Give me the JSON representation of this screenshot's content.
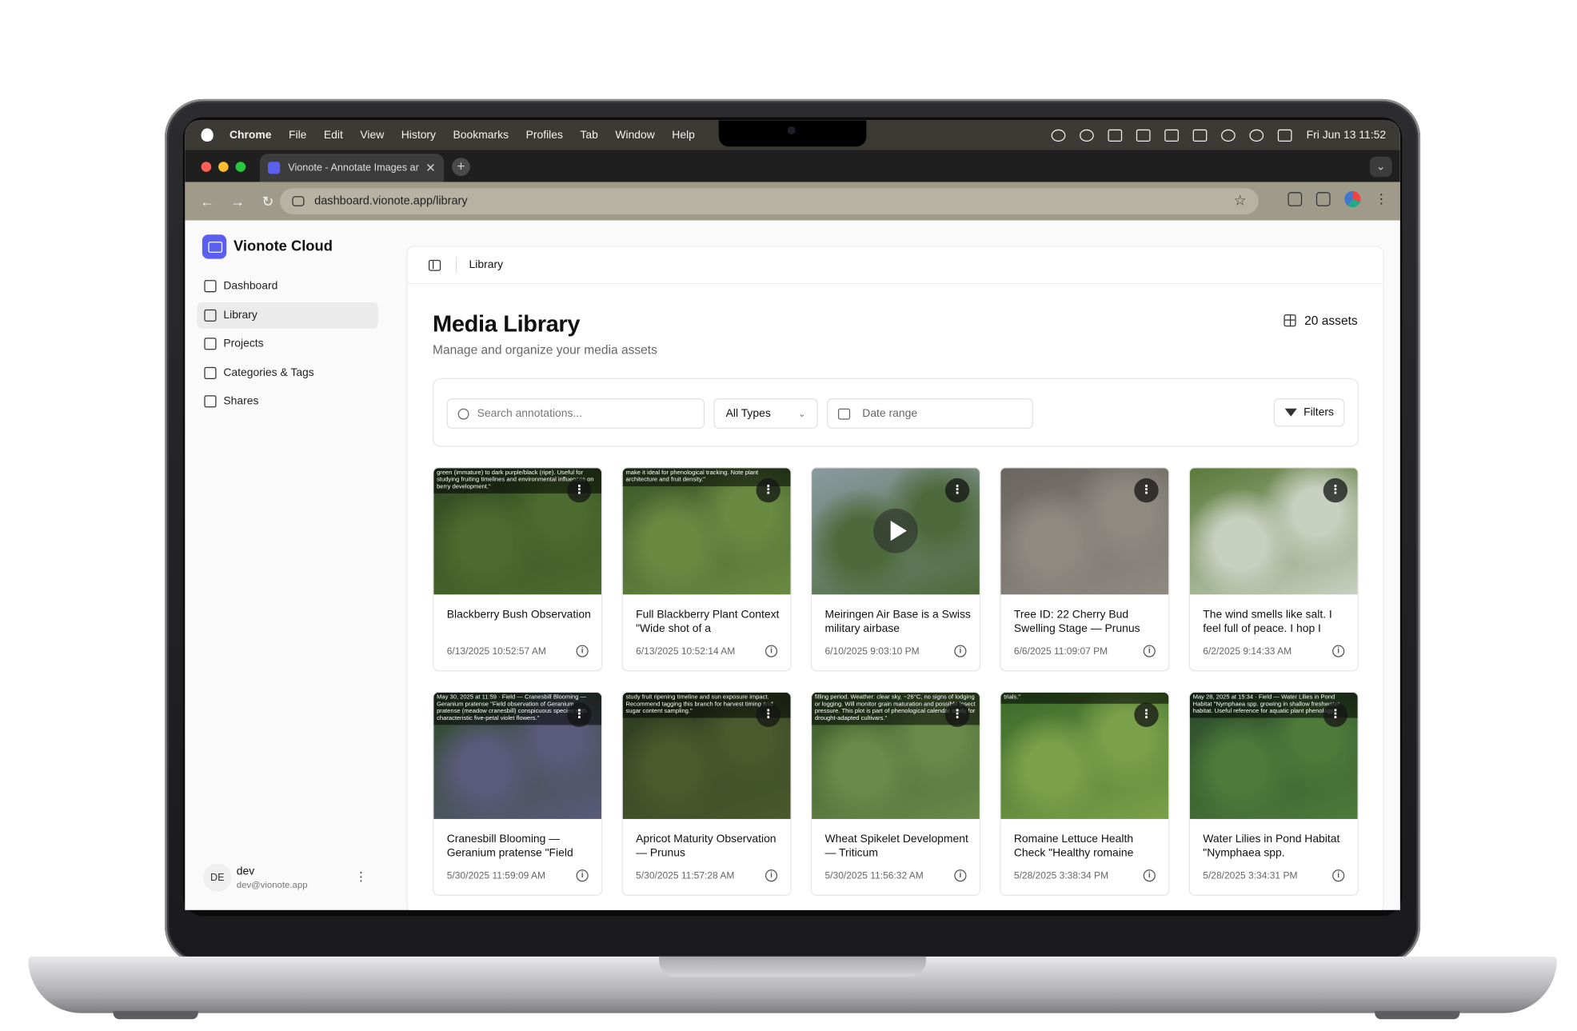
{
  "menubar": {
    "items": [
      "Chrome",
      "File",
      "Edit",
      "View",
      "History",
      "Bookmarks",
      "Profiles",
      "Tab",
      "Window",
      "Help"
    ],
    "clock": "Fri Jun 13  11:52"
  },
  "browser": {
    "tab_title": "Vionote - Annotate Images ar",
    "url": "dashboard.vionote.app/library"
  },
  "sidebar": {
    "brand": "Vionote Cloud",
    "items": [
      {
        "label": "Dashboard",
        "icon": "dashboard-icon"
      },
      {
        "label": "Library",
        "icon": "image-icon",
        "active": true
      },
      {
        "label": "Projects",
        "icon": "folder-icon"
      },
      {
        "label": "Categories & Tags",
        "icon": "tag-icon"
      },
      {
        "label": "Shares",
        "icon": "share-icon"
      }
    ],
    "user": {
      "initials": "DE",
      "name": "dev",
      "email": "dev@vionote.app"
    }
  },
  "main": {
    "breadcrumb": "Library",
    "title": "Media Library",
    "subtitle": "Manage and organize your media assets",
    "asset_count": "20 assets",
    "search_placeholder": "Search annotations...",
    "type_filter": "All Types",
    "date_placeholder": "Date range",
    "filters_label": "Filters"
  },
  "assets": [
    {
      "title": "Blackberry Bush Observation",
      "date": "6/13/2025 10:52:57 AM",
      "overlay": "green (immature) to dark purple/black (ripe). Useful for studying fruiting timelines and environmental influences on berry development.\"",
      "colors": [
        "#2f4a22",
        "#4d6b2e"
      ]
    },
    {
      "title": "Full Blackberry Plant Context \"Wide shot of a",
      "date": "6/13/2025 10:52:14 AM",
      "overlay": "make it ideal for phenological tracking. Note plant architecture and fruit density.\"",
      "colors": [
        "#3c5a2a",
        "#6a8a42"
      ]
    },
    {
      "title": "Meiringen Air Base is a Swiss military airbase",
      "date": "6/10/2025 9:03:10 PM",
      "overlay": "",
      "video": true,
      "colors": [
        "#8a9aa0",
        "#4e6a3c"
      ]
    },
    {
      "title": "Tree ID: 22 Cherry Bud Swelling Stage — Prunus",
      "date": "6/6/2025 11:09:07 PM",
      "overlay": "",
      "colors": [
        "#6a6560",
        "#8e8a82"
      ]
    },
    {
      "title": "The wind smells like salt. I feel full of peace. I hop I",
      "date": "6/2/2025 9:14:33 AM",
      "overlay": "",
      "colors": [
        "#5a7a3a",
        "#c8d0c0"
      ]
    },
    {
      "title": "Cranesbill Blooming — Geranium pratense \"Field",
      "date": "5/30/2025 11:59:09 AM",
      "overlay": "May 30, 2025 at 11:59 · Field — Cranesbill Blooming — Geranium pratense \"Field observation of Geranium pratense (meadow cranesbill) conspicuous species with characteristic five-petal violet flowers.\"",
      "colors": [
        "#2e4a28",
        "#5a5a7a"
      ]
    },
    {
      "title": "Apricot Maturity Observation — Prunus",
      "date": "5/30/2025 11:57:28 AM",
      "overlay": "study fruit ripening timeline and sun exposure impact. Recommend tagging this branch for harvest timing and sugar content sampling.\"",
      "colors": [
        "#2c3a20",
        "#4a5a2c"
      ]
    },
    {
      "title": "Wheat Spikelet Development — Triticum",
      "date": "5/30/2025 11:56:32 AM",
      "overlay": "filling period. Weather: clear sky, ~26°C, no signs of lodging or logging. Will monitor grain maturation and possible insect pressure. This plot is part of phenological calendar study for drought-adapted cultivars.\"",
      "colors": [
        "#3a5a2a",
        "#6a8a4a"
      ]
    },
    {
      "title": "Romaine Lettuce Health Check \"Healthy romaine",
      "date": "5/28/2025 3:38:34 PM",
      "overlay": "trials.\"",
      "colors": [
        "#3c6a2a",
        "#7aa04a"
      ]
    },
    {
      "title": "Water Lilies in Pond Habitat \"Nymphaea spp.",
      "date": "5/28/2025 3:34:31 PM",
      "overlay": "May 28, 2025 at 15:34 · Field — Water Lilies in Pond Habitat \"Nymphaea spp. growing in shallow freshwater habitat. Useful reference for aquatic plant phenology.\"",
      "colors": [
        "#2a4a2c",
        "#4e7a3a"
      ]
    }
  ]
}
